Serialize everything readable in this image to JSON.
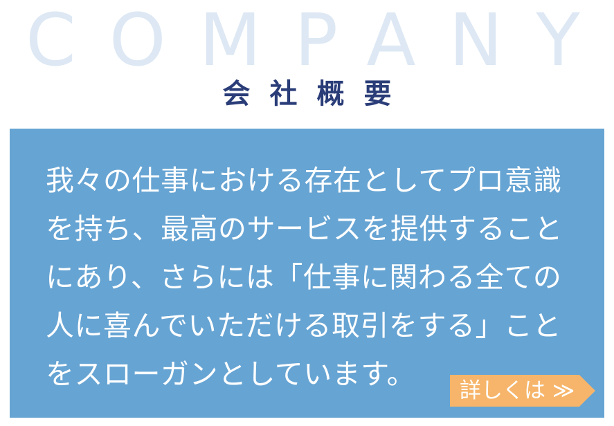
{
  "header": {
    "title_en": "COMPANY",
    "title_ja": "会社概要"
  },
  "main": {
    "message_lines": [
      "我々の仕事における存在としてプロ意識",
      "を持ち、最高のサービスを提供すること",
      "にあり、さらには「仕事に関わる全ての",
      "人に喜んでいただける取引をする」こと",
      "をスローガンとしています。"
    ],
    "more_label": "詳しくは ≫"
  },
  "colors": {
    "panel_background": "#66a4d3",
    "button_background": "#f6b56a",
    "heading_en": "#dde8f4",
    "heading_ja": "#2a3d78"
  }
}
